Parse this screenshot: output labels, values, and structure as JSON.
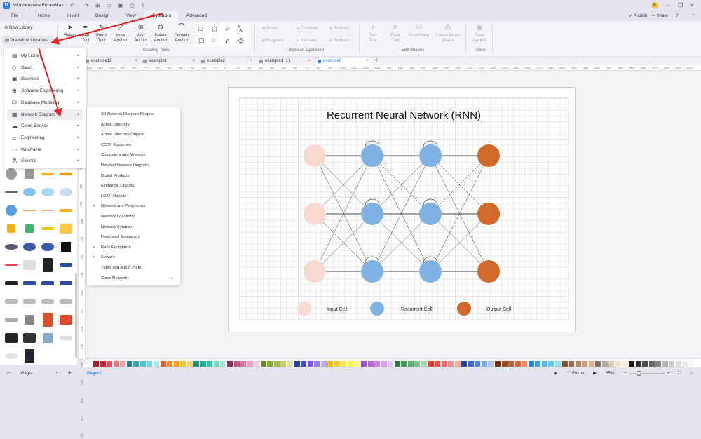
{
  "app": {
    "title": "Wondershare EdrawMax",
    "logo_letter": "D",
    "user_initial": "R"
  },
  "menu_tabs": [
    "File",
    "Home",
    "Insert",
    "Design",
    "View",
    "Symbols",
    "Advanced"
  ],
  "active_tab": "Symbols",
  "header_actions": {
    "publish": "Publish",
    "share": "Share"
  },
  "ribbon": {
    "library": {
      "new": "New Library",
      "predefine": "Predefine Libraries"
    },
    "drawing_tools": {
      "label": "Drawing Tools",
      "items": [
        "Select",
        "Pen Tool",
        "Pencil Tool",
        "Move Anchor",
        "Add Anchor",
        "Delete Anchor",
        "Convert Anchor"
      ]
    },
    "boolean": {
      "label": "Boolean Operation",
      "items": [
        "Union",
        "Combine",
        "Subtract",
        "Fragment",
        "Intersect",
        "Subtract"
      ]
    },
    "edit_shapes": {
      "label": "Edit Shapes",
      "items": [
        "Text Tool",
        "Point Tool",
        "DataSheet",
        "Create Smart Shape"
      ]
    },
    "save": {
      "label": "Save",
      "items": [
        "Save Symbol"
      ]
    }
  },
  "doc_tabs": [
    {
      "name": "example12",
      "state": "close"
    },
    {
      "name": "example1",
      "state": "close"
    },
    {
      "name": "example2",
      "state": "modified"
    },
    {
      "name": "example1 (1)",
      "state": "modified"
    },
    {
      "name": "example9",
      "state": "active-modified"
    }
  ],
  "ruler_h": [
    "-120",
    "-110",
    "-100",
    "-90",
    "-80",
    "-70",
    "-60",
    "-50",
    "-40",
    "-30",
    "-20",
    "-10",
    "0",
    "10",
    "20",
    "30",
    "40",
    "50",
    "60",
    "70",
    "80",
    "90",
    "100",
    "110",
    "120",
    "130",
    "140",
    "150",
    "160",
    "170",
    "180",
    "190",
    "200",
    "210",
    "220",
    "230",
    "240",
    "250",
    "260",
    "270",
    "280",
    "290",
    "300",
    "310",
    "320",
    "330",
    "340",
    "350",
    "360",
    "370",
    "380",
    "390",
    "400"
  ],
  "ruler_v": [
    "70",
    "80",
    "90",
    "100",
    "110",
    "120",
    "130",
    "140",
    "150",
    "160",
    "170",
    "180",
    "190",
    "200",
    "210",
    "220"
  ],
  "library_menu": {
    "items": [
      {
        "label": "My Library",
        "icon": "folder-icon"
      },
      {
        "label": "Basic",
        "icon": "tag-icon"
      },
      {
        "label": "Business",
        "icon": "presentation-icon"
      },
      {
        "label": "Software Engineering",
        "icon": "flowchart-icon"
      },
      {
        "label": "Database Modeling",
        "icon": "database-icon"
      },
      {
        "label": "Network Diagram",
        "icon": "calendar-network-icon"
      },
      {
        "label": "Cloud Service",
        "icon": "cloud-icon"
      },
      {
        "label": "Engineering",
        "icon": "hardhat-icon"
      },
      {
        "label": "Wireframe",
        "icon": "wireframe-icon"
      },
      {
        "label": "Science",
        "icon": "flask-icon"
      }
    ],
    "highlighted": "Network Diagram"
  },
  "network_submenu": [
    {
      "label": "3D Network Diagram Shapes",
      "checked": false
    },
    {
      "label": "Active Directory",
      "checked": false
    },
    {
      "label": "Active Directory Objects",
      "checked": false
    },
    {
      "label": "CCTV Equipment",
      "checked": false
    },
    {
      "label": "Computers and Monitors",
      "checked": false
    },
    {
      "label": "Detailed Network Diagram",
      "checked": false
    },
    {
      "label": "Digital Products",
      "checked": false
    },
    {
      "label": "Exchange Objects",
      "checked": false
    },
    {
      "label": "LDAP Objects",
      "checked": false
    },
    {
      "label": "Network and Peripherals",
      "checked": true
    },
    {
      "label": "Network Locations",
      "checked": false
    },
    {
      "label": "Network Symbols",
      "checked": false
    },
    {
      "label": "Peripheral Equipment",
      "checked": false
    },
    {
      "label": "Rack Equipment",
      "checked": true
    },
    {
      "label": "Servers",
      "checked": true
    },
    {
      "label": "Video and Audio Ports",
      "checked": false
    },
    {
      "label": "Cisco Network",
      "checked": false,
      "submenu": true
    }
  ],
  "diagram": {
    "title": "Recurrent Neural Network (RNN)",
    "colors": {
      "input": "#f7d9cf",
      "recurrent": "#7fb2e3",
      "output": "#d2692a"
    },
    "layers": [
      "input",
      "recurrent",
      "recurrent",
      "output"
    ],
    "nodes_per_layer": 3,
    "legend": [
      {
        "label": "Input Cell",
        "type": "input"
      },
      {
        "label": "Recurrent Cell",
        "type": "recurrent"
      },
      {
        "label": "Output Cell",
        "type": "output"
      }
    ]
  },
  "palette": [
    "#b5182b",
    "#d21f35",
    "#ea4a5a",
    "#f06c7c",
    "#f4a3ad",
    "#2e7d8c",
    "#3aa6bf",
    "#4cc0dc",
    "#6dd6ef",
    "#a9e8f7",
    "#f05a22",
    "#f78a30",
    "#fba21c",
    "#fcbf2a",
    "#fdd069",
    "#14907a",
    "#1ab394",
    "#2cc4a5",
    "#6ed8c3",
    "#a0e8d8",
    "#9a2a5e",
    "#c94f86",
    "#e56ea6",
    "#f597c2",
    "#f6c8dc",
    "#5f8a1c",
    "#7ea52c",
    "#a0c03a",
    "#bcd45f",
    "#d6e4a0",
    "#2b3fa8",
    "#3a4fd8",
    "#7b4fe8",
    "#9b7cf0",
    "#b9a6f5",
    "#fbb40f",
    "#fcc92d",
    "#fde24d",
    "#fdf04f",
    "#fef77c",
    "#9a4fd8",
    "#c05fe8",
    "#cf7cf0",
    "#d59af5",
    "#e4bff8",
    "#2e7d3c",
    "#3a9d50",
    "#56b370",
    "#78c68c",
    "#a2dab0",
    "#e8372a",
    "#f04e3e",
    "#f5636b",
    "#f78789",
    "#f9a9a0",
    "#2340a0",
    "#3a63d8",
    "#4a80f0",
    "#7aa3f5",
    "#a7c5f8",
    "#7b3000",
    "#a84015",
    "#c45a30",
    "#d86a40",
    "#ec8c60",
    "#1f8ad8",
    "#3aa0f0",
    "#4ab6f5",
    "#5ecaf8",
    "#8ae0fc",
    "#8a5030",
    "#a06a48",
    "#b88060",
    "#d49a78",
    "#f0a880",
    "#807070",
    "#b8a898",
    "#d8cab8",
    "#ece0d0",
    "#f8f0d8",
    "#1a1a1a",
    "#333333",
    "#4d4d4d",
    "#666666",
    "#808080",
    "#b3b3b3",
    "#cccccc",
    "#dddddd",
    "#e8e8e8",
    "#f5f5f5"
  ],
  "status": {
    "page_selector": "Page-1",
    "page_tab": "Page-1",
    "focus": "Focus",
    "zoom": "85%",
    "zoom_level": 0.25
  }
}
